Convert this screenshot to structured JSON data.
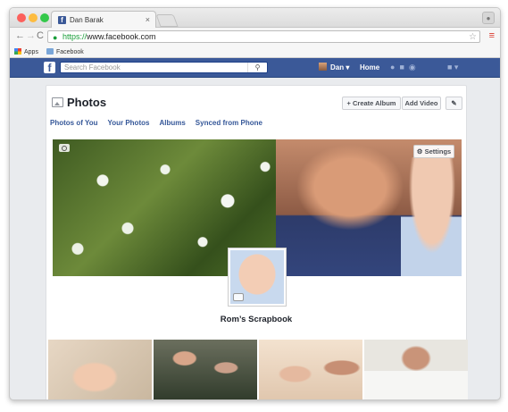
{
  "browser": {
    "tab_title": "Dan Barak",
    "tab_close": "×",
    "url_https": "https://",
    "url_rest": "www.facebook.com",
    "bookmarks": [
      {
        "label": "Apps"
      },
      {
        "label": "Facebook"
      }
    ],
    "colors": {
      "close": "#fc605c",
      "minimize": "#fdbc40",
      "maximize": "#34c84a"
    }
  },
  "facebook_bar": {
    "logo": "f",
    "search_placeholder": "Search Facebook",
    "user_name": "Dan",
    "home_label": "Home",
    "brand_color": "#3b5998"
  },
  "photos_page": {
    "title": "Photos",
    "create_album_label": "+ Create Album",
    "add_video_label": "Add Video",
    "tabs": [
      {
        "label": "Photos of You"
      },
      {
        "label": "Your Photos"
      },
      {
        "label": "Albums"
      },
      {
        "label": "Synced from Phone"
      }
    ],
    "settings_label": "Settings",
    "album_title": "Rom’s Scrapbook"
  },
  "icons": [
    "lock-icon",
    "star-icon",
    "menu-icon",
    "search-icon",
    "camera-icon",
    "gear-icon",
    "pencil-icon",
    "friends-icon",
    "messages-icon",
    "globe-icon",
    "lock-shortcuts-icon"
  ]
}
